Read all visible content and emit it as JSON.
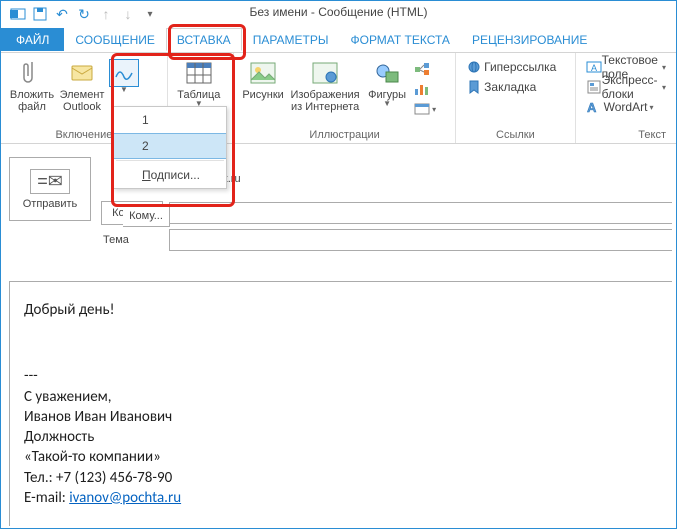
{
  "window": {
    "title": "Без имени - Сообщение (HTML)"
  },
  "tabs": {
    "file": "ФАЙЛ",
    "message": "СООБЩЕНИЕ",
    "insert": "ВСТАВКА",
    "options": "ПАРАМЕТРЫ",
    "format": "ФОРМАТ ТЕКСТА",
    "review": "РЕЦЕНЗИРОВАНИЕ"
  },
  "ribbon": {
    "include": {
      "attach_file": "Вложить файл",
      "outlook_item": "Элемент Outlook",
      "group_label": "Включение"
    },
    "tables": {
      "table": "Таблица"
    },
    "illustrations": {
      "pictures": "Рисунки",
      "online_pictures_l1": "Изображения",
      "online_pictures_l2": "из Интернета",
      "shapes": "Фигуры",
      "group_label": "Иллюстрации"
    },
    "links": {
      "hyperlink": "Гиперссылка",
      "bookmark": "Закладка",
      "group_label": "Ссылки"
    },
    "text": {
      "textbox": "Текстовое поле",
      "quickparts": "Экспресс-блоки",
      "wordart": "WordArt",
      "group_label": "Текст"
    }
  },
  "signature_menu": {
    "item1": "1",
    "item2": "2",
    "signatures_prefix": "П",
    "signatures_rest": "одписи..."
  },
  "compose": {
    "send": "Отправить",
    "copy": "Копия...",
    "subject_label": "Тема",
    "to_leak_text": "rt.ru",
    "to_btn_leak": "Кому..."
  },
  "body": {
    "greeting": "Добрый день!",
    "sep": "---",
    "regards": "С уважением,",
    "name": "Иванов Иван Иванович",
    "position": "Должность",
    "company": "«Такой-то компании»",
    "phone": "Тел.: +7 (123) 456-78-90",
    "email_label": "E-mail: ",
    "email": "ivanov@pochta.ru"
  }
}
